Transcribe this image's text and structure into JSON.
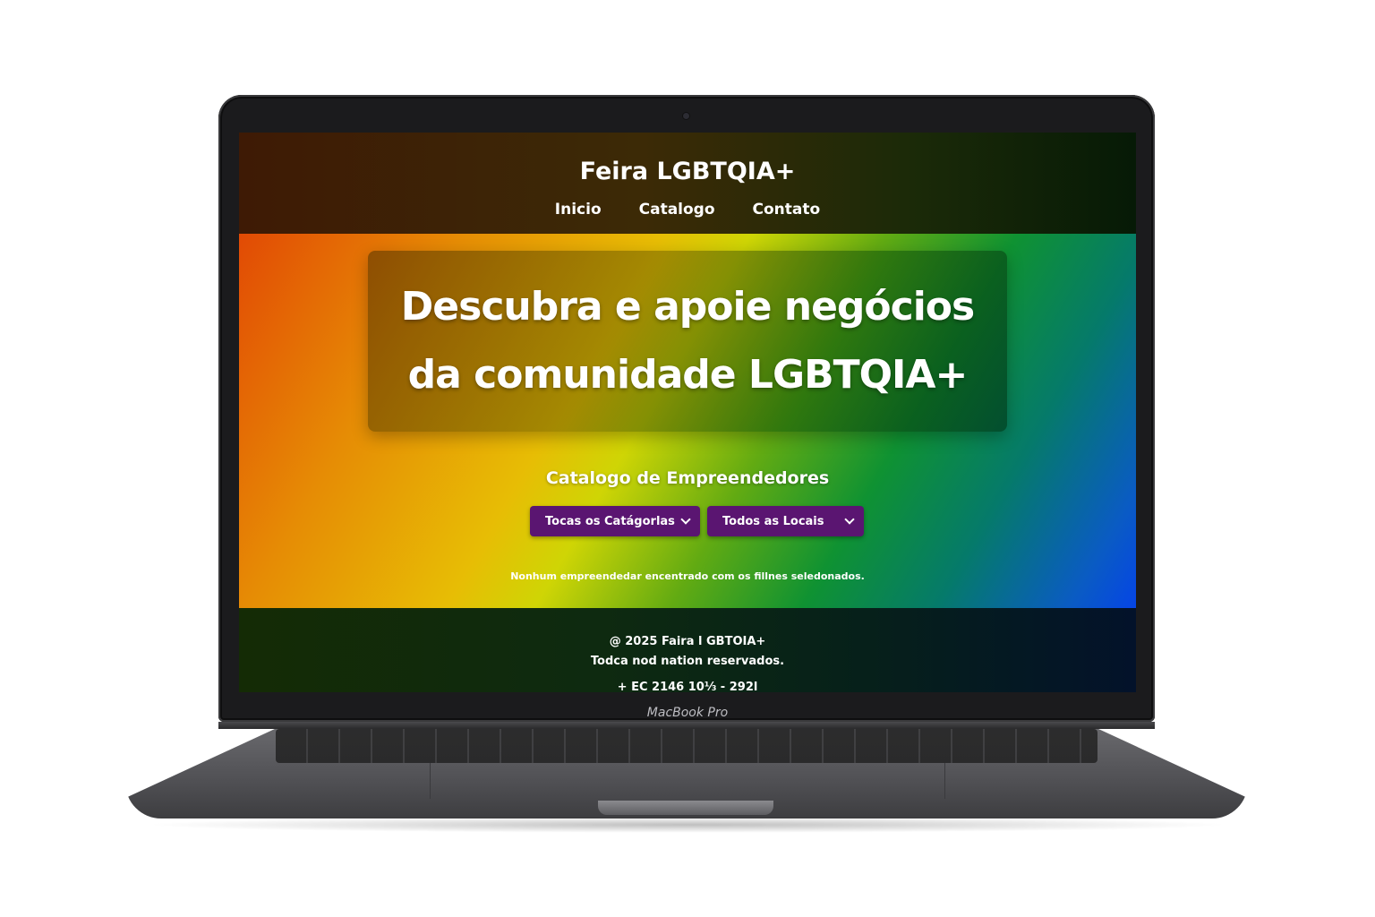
{
  "device": {
    "label": "MacBook Pro"
  },
  "site": {
    "title": "Feira LGBTQIA+",
    "nav": [
      "Inicio",
      "Catalogo",
      "Contato"
    ],
    "hero": {
      "headline": "Descubra e apoie negócios da comunidade LGBTQIA+"
    },
    "catalog": {
      "title": "Catalogo de Empreendedores",
      "category_filter": "Tocas os Catágorlas",
      "location_filter": "Todos as Locais",
      "empty_message": "Nonhum empreendedar encentrado com os fillnes seledonados."
    },
    "footer": {
      "copyright": "@ 2025 Faira l GBTOIA+",
      "rights": "Todca nod nation reservados.",
      "phone": "+ EC 2146 10⅓ - 292l"
    }
  },
  "colors": {
    "dropdown_bg": "#5a1571",
    "text": "#ffffff"
  }
}
